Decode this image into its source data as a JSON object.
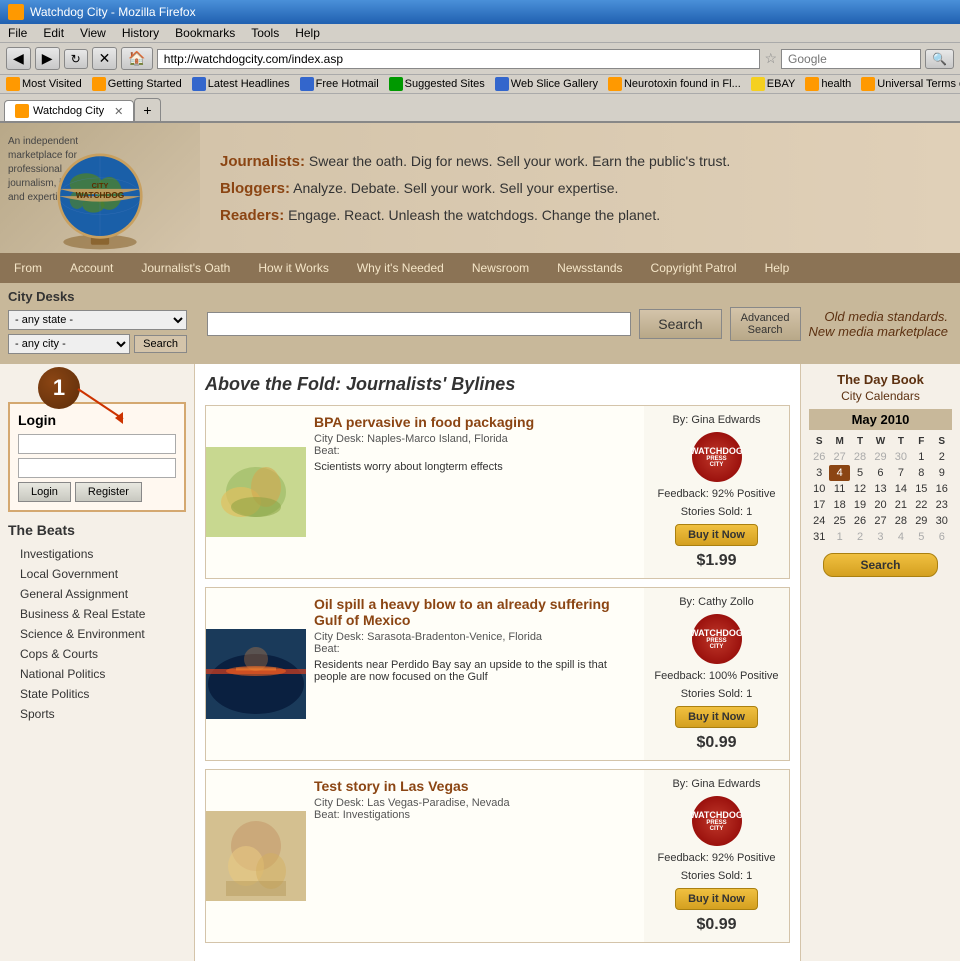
{
  "browser": {
    "title": "Watchdog City - Mozilla Firefox",
    "url": "http://watchdogcity.com/index.asp",
    "search_placeholder": "Google",
    "menus": [
      "File",
      "Edit",
      "View",
      "History",
      "Bookmarks",
      "Tools",
      "Help"
    ],
    "bookmarks": [
      {
        "label": "Most Visited",
        "icon": "orange"
      },
      {
        "label": "Getting Started",
        "icon": "orange"
      },
      {
        "label": "Latest Headlines",
        "icon": "blue"
      },
      {
        "label": "Free Hotmail",
        "icon": "blue"
      },
      {
        "label": "Suggested Sites",
        "icon": "orange"
      },
      {
        "label": "Web Slice Gallery",
        "icon": "blue"
      },
      {
        "label": "Neurotoxin found in Fl...",
        "icon": "orange"
      },
      {
        "label": "EBAY",
        "icon": "yellow"
      },
      {
        "label": "health",
        "icon": "orange"
      },
      {
        "label": "Universal Terms of",
        "icon": "orange"
      }
    ],
    "tab_label": "Watchdog City"
  },
  "site": {
    "taglines": {
      "journalists": "Journalists:",
      "journalists_text": "Swear the oath. Dig for news. Sell your work. Earn the public's trust.",
      "bloggers": "Bloggers:",
      "bloggers_text": "Analyze. Debate. Sell your work. Sell your expertise.",
      "readers": "Readers:",
      "readers_text": "Engage. React. Unleash the watchdogs. Change the planet."
    },
    "logo_description": "An independent marketplace for professional journalism, ideas and expertise.",
    "nav_items": [
      "From",
      "Account",
      "Journalist's Oath",
      "How it Works",
      "Why it's Needed",
      "Newsroom",
      "Newsstands",
      "Copyright Patrol",
      "Help"
    ],
    "search": {
      "placeholder": "",
      "search_btn": "Search",
      "adv_btn": "Advanced\nSearch",
      "old_media": "Old media standards.\nNew media marketplace"
    },
    "city_desks": {
      "title": "City Desks",
      "state_default": "- any state -",
      "city_default": "- any city -",
      "search_btn": "Search"
    },
    "login": {
      "title": "Login",
      "username_placeholder": "",
      "password_placeholder": "",
      "login_btn": "Login",
      "register_btn": "Register"
    },
    "beats": {
      "title": "The Beats",
      "items": [
        "Investigations",
        "Local Government",
        "General Assignment",
        "Business & Real Estate",
        "Science & Environment",
        "Cops & Courts",
        "National Politics",
        "State Politics",
        "Sports"
      ]
    },
    "section_title": "Above the Fold: Journalists' Bylines",
    "articles": [
      {
        "title": "BPA pervasive in food packaging",
        "desk": "City Desk: Naples-Marco Island, Florida",
        "beat": "Beat:",
        "description": "Scientists worry about longterm effects",
        "author": "By: Gina Edwards",
        "feedback": "Feedback: 92% Positive",
        "sold": "Stories Sold: 1",
        "price": "$1.99",
        "buy_btn": "Buy it Now",
        "img_color": "#c8d890"
      },
      {
        "title": "Oil spill a heavy blow to an already suffering Gulf of Mexico",
        "desk": "City Desk: Sarasota-Bradenton-Venice, Florida",
        "beat": "Beat:",
        "description": "Residents near Perdido Bay say an upside to the spill is that people are now focused on the Gulf",
        "author": "By: Cathy Zollo",
        "feedback": "Feedback: 100% Positive",
        "sold": "Stories Sold: 1",
        "price": "$0.99",
        "buy_btn": "Buy it Now",
        "img_color": "#d4703030"
      },
      {
        "title": "Test story in Las Vegas",
        "desk": "City Desk: Las Vegas-Paradise, Nevada",
        "beat": "Beat: Investigations",
        "description": "",
        "author": "By: Gina Edwards",
        "feedback": "Feedback: 92% Positive",
        "sold": "Stories Sold: 1",
        "price": "$0.99",
        "buy_btn": "Buy it Now",
        "img_color": "#d4c090"
      }
    ],
    "calendar": {
      "daybook": "The Day Book",
      "city_calendars": "City Calendars",
      "month": "May 2010",
      "headers": [
        "S",
        "M",
        "T",
        "W",
        "T",
        "F",
        "S"
      ],
      "weeks": [
        [
          "26",
          "27",
          "28",
          "29",
          "30",
          "1",
          "2"
        ],
        [
          "3",
          "4",
          "5",
          "6",
          "7",
          "8",
          "9"
        ],
        [
          "10",
          "11",
          "12",
          "13",
          "14",
          "15",
          "16"
        ],
        [
          "17",
          "18",
          "19",
          "20",
          "21",
          "22",
          "23"
        ],
        [
          "24",
          "25",
          "26",
          "27",
          "28",
          "29",
          "30"
        ],
        [
          "31",
          "1",
          "2",
          "3",
          "4",
          "5",
          "6"
        ]
      ],
      "today": "4",
      "search_btn": "Search"
    }
  },
  "badge": {
    "number": "1"
  }
}
